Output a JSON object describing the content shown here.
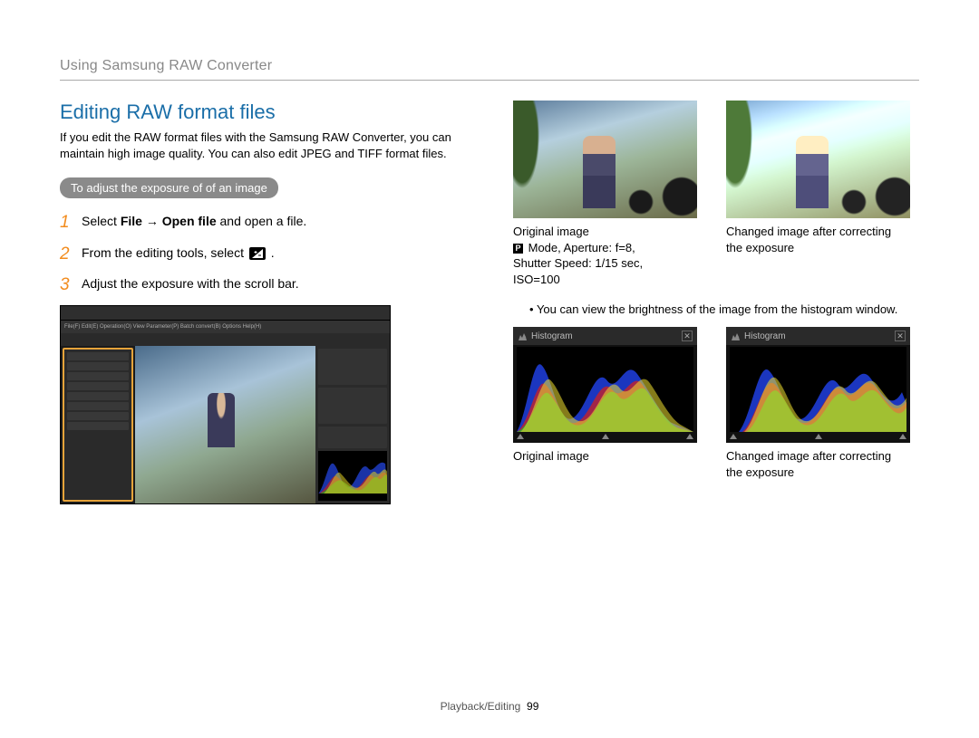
{
  "header": {
    "breadcrumb": "Using Samsung RAW Converter"
  },
  "left": {
    "title": "Editing RAW format files",
    "intro": "If you edit the RAW format files with the Samsung RAW Converter, you can maintain high image quality. You can also edit JPEG and TIFF format files.",
    "pill": "To adjust the exposure of of an image",
    "steps": {
      "s1": {
        "num": "1",
        "pre": "Select ",
        "bold1": "File",
        "arrow": " → ",
        "bold2": "Open file",
        "post": " and open a file."
      },
      "s2": {
        "num": "2",
        "pre": "From the editing tools, select ",
        "post": " ."
      },
      "s3": {
        "num": "3",
        "text": "Adjust the exposure with the scroll bar."
      }
    },
    "app_menu": "File(F)  Edit(E)  Operation(O)  View  Parameter(P)  Batch convert(B)  Options  Help(H)"
  },
  "right": {
    "photo1_caption_line1": "Original image",
    "photo1_caption_line2_pre": " Mode, Aperture: f=8,",
    "photo1_caption_line3": "Shutter Speed: 1/15 sec,",
    "photo1_caption_line4": "ISO=100",
    "photo2_caption_line1": "Changed image after correcting",
    "photo2_caption_line2": "the exposure",
    "note": "You can view the brightness of the image from the histogram window.",
    "hist_label": "Histogram",
    "hist1_caption": "Original image",
    "hist2_caption_line1": "Changed image after correcting",
    "hist2_caption_line2": "the exposure",
    "p_letter": "P"
  },
  "footer": {
    "section": "Playback/Editing",
    "page": "99"
  }
}
